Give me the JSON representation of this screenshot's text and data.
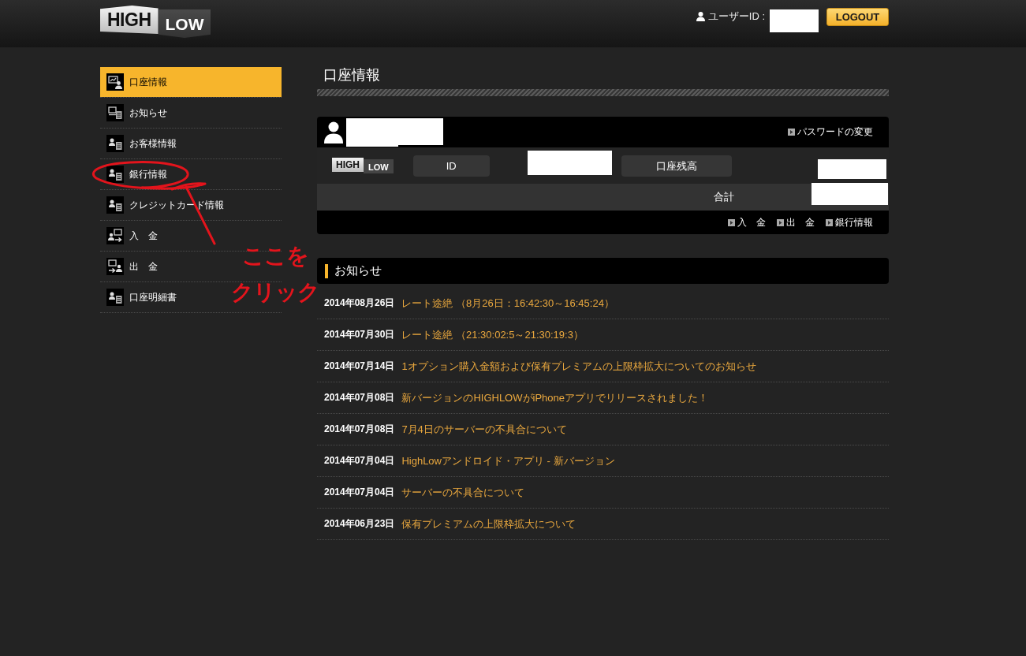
{
  "header": {
    "logo": [
      "HIGH",
      "LOW"
    ],
    "user_label": "ユーザーID :",
    "logout": "LOGOUT"
  },
  "sidebar": {
    "items": [
      {
        "label": "口座情報",
        "kind": "account",
        "selected": true
      },
      {
        "label": "お知らせ",
        "kind": "notice",
        "selected": false
      },
      {
        "label": "お客様情報",
        "kind": "profile",
        "selected": false
      },
      {
        "label": "銀行情報",
        "kind": "profile",
        "selected": false
      },
      {
        "label": "クレジットカード情報",
        "kind": "profile",
        "selected": false
      },
      {
        "label": "入　金",
        "kind": "deposit",
        "selected": false
      },
      {
        "label": "出　金",
        "kind": "withdraw",
        "selected": false
      },
      {
        "label": "口座明細書",
        "kind": "profile",
        "selected": false
      }
    ]
  },
  "page_title": "口座情報",
  "account": {
    "password_link": "パスワードの変更",
    "logo": [
      "HIGH",
      "LOW"
    ],
    "id_label": "ID",
    "balance_label": "口座残高",
    "total_label": "合計",
    "links": [
      "入　金",
      "出　金",
      "銀行情報"
    ]
  },
  "notices": {
    "title": "お知らせ",
    "items": [
      {
        "date": "2014年08月26日",
        "title": "レート途絶 （8月26日：16:42:30～16:45:24）"
      },
      {
        "date": "2014年07月30日",
        "title": "レート途絶 （21:30:02:5～21:30:19:3）"
      },
      {
        "date": "2014年07月14日",
        "title": "1オプション購入金額および保有プレミアムの上限枠拡大についてのお知らせ"
      },
      {
        "date": "2014年07月08日",
        "title": "新バージョンのHIGHLOWがiPhoneアプリでリリースされました！"
      },
      {
        "date": "2014年07月08日",
        "title": "7月4日のサーバーの不具合について"
      },
      {
        "date": "2014年07月04日",
        "title": "HighLowアンドロイド・アプリ - 新バージョン"
      },
      {
        "date": "2014年07月04日",
        "title": "サーバーの不具合について"
      },
      {
        "date": "2014年06月23日",
        "title": "保有プレミアムの上限枠拡大について"
      }
    ]
  },
  "annotation": {
    "lines": [
      "ここを",
      "クリック"
    ]
  }
}
